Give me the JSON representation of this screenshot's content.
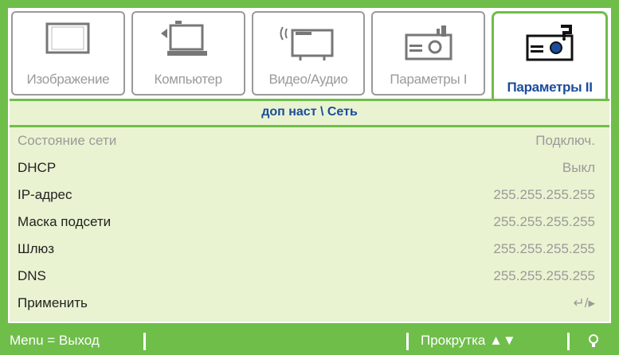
{
  "tabs": [
    {
      "label": "Изображение",
      "icon": "monitor-icon"
    },
    {
      "label": "Компьютер",
      "icon": "laptop-icon"
    },
    {
      "label": "Видео/Аудио",
      "icon": "video-audio-icon"
    },
    {
      "label": "Параметры I",
      "icon": "projector-icon"
    },
    {
      "label": "Параметры II",
      "icon": "projector-settings-icon"
    }
  ],
  "section_title": "доп наст \\ Сеть",
  "rows": [
    {
      "label": "Состояние сети",
      "value": "Подключ."
    },
    {
      "label": "DHCP",
      "value": "Выкл"
    },
    {
      "label": "IP-адрес",
      "value": "255.255.255.255"
    },
    {
      "label": "Маска подсети",
      "value": "255.255.255.255"
    },
    {
      "label": "Шлюз",
      "value": "255.255.255.255"
    },
    {
      "label": "DNS",
      "value": "255.255.255.255"
    },
    {
      "label": "Применить",
      "value": "↵/▸"
    }
  ],
  "footer": {
    "menu_exit": "Menu = Выход",
    "scroll": "Прокрутка ▲▼",
    "light_icon": "bulb-icon"
  },
  "colors": {
    "accent": "#6fbe4a",
    "panel": "#e9f3d1",
    "label_active": "#1b4c9c",
    "dim": "#9a9a9a"
  }
}
